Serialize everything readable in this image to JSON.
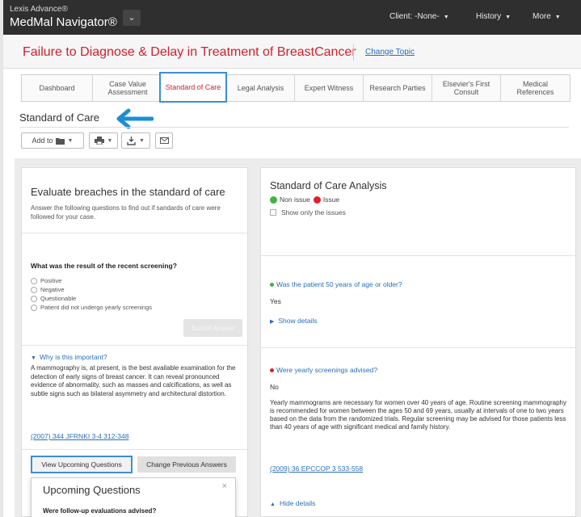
{
  "header": {
    "brand_small": "Lexis Advance®",
    "brand_name": "MedMal Navigator®",
    "client_label": "Client: -None-",
    "history_label": "History",
    "more_label": "More"
  },
  "topic": {
    "title": "Failure to Diagnose & Delay in Treatment of BreastCancer",
    "change_link": "Change Topic"
  },
  "tabs": [
    {
      "label": "Dashboard"
    },
    {
      "label": "Case Value Assessment"
    },
    {
      "label": "Standard of Care",
      "active": true
    },
    {
      "label": "Legal Analysis"
    },
    {
      "label": "Expert Witness"
    },
    {
      "label": "Research Parties"
    },
    {
      "label": "Elsevier's First Consult"
    },
    {
      "label": "Medical References"
    }
  ],
  "section": {
    "title": "Standard of Care"
  },
  "toolbar": {
    "add_to_label": "Add to",
    "icons": [
      "folder-icon",
      "print-icon",
      "download-icon",
      "email-icon"
    ]
  },
  "evaluate": {
    "title": "Evaluate breaches in the standard of care",
    "intro": "Answer the following questions to find out if sandards of care were followed for your case.",
    "question": "What was the result of the recent screening?",
    "options": [
      "Positive",
      "Negative",
      "Questionable",
      "Patient did not undergo yearly screenings"
    ],
    "submit_label": "Submit Answer",
    "why_link": "Why is this important?",
    "why_text": "A mammography is, at present, is the best available examination for the detection of early signs of breast cancer. It can reveal pronounced evidence of abnormality, such as masses and calcifications, as well as subtle signs such as bilateral asymmetry and architectural distortion.",
    "citation": "(2007) 344 JFRNKI 3-4 312-348",
    "view_upcoming_label": "View Upcoming Questions",
    "change_previous_label": "Change Previous Answers",
    "popup_title": "Upcoming Questions",
    "popup_close": "×",
    "popup_question": "Were follow-up evaluations advised?"
  },
  "analysis": {
    "title": "Standard of Care Analysis",
    "legend_non_issue": "Non issue",
    "legend_issue": "Issue",
    "show_only_label": "Show only the issues",
    "non_issue_color": "#3fb53f",
    "issue_color": "#e0202a",
    "items": [
      {
        "question": "Was the patient 50 years of age or older?",
        "answer": "Yes",
        "toggle": "Show details"
      },
      {
        "question": "Were yearly screenings advised?",
        "answer": "No",
        "explanation": "Yearly mammograms are necessary for women over 40 years of age. Routine screening mammography is recommended for women between the ages 50 and 69 years, usually at intervals of one to two years based on the data from the randomized trials. Regular screening may be advised for those patients less than 40 years of age with significant medical and family history.",
        "citation": "(2009) 36 EPCCOP 3 533-558",
        "toggle": "Hide details"
      }
    ]
  }
}
